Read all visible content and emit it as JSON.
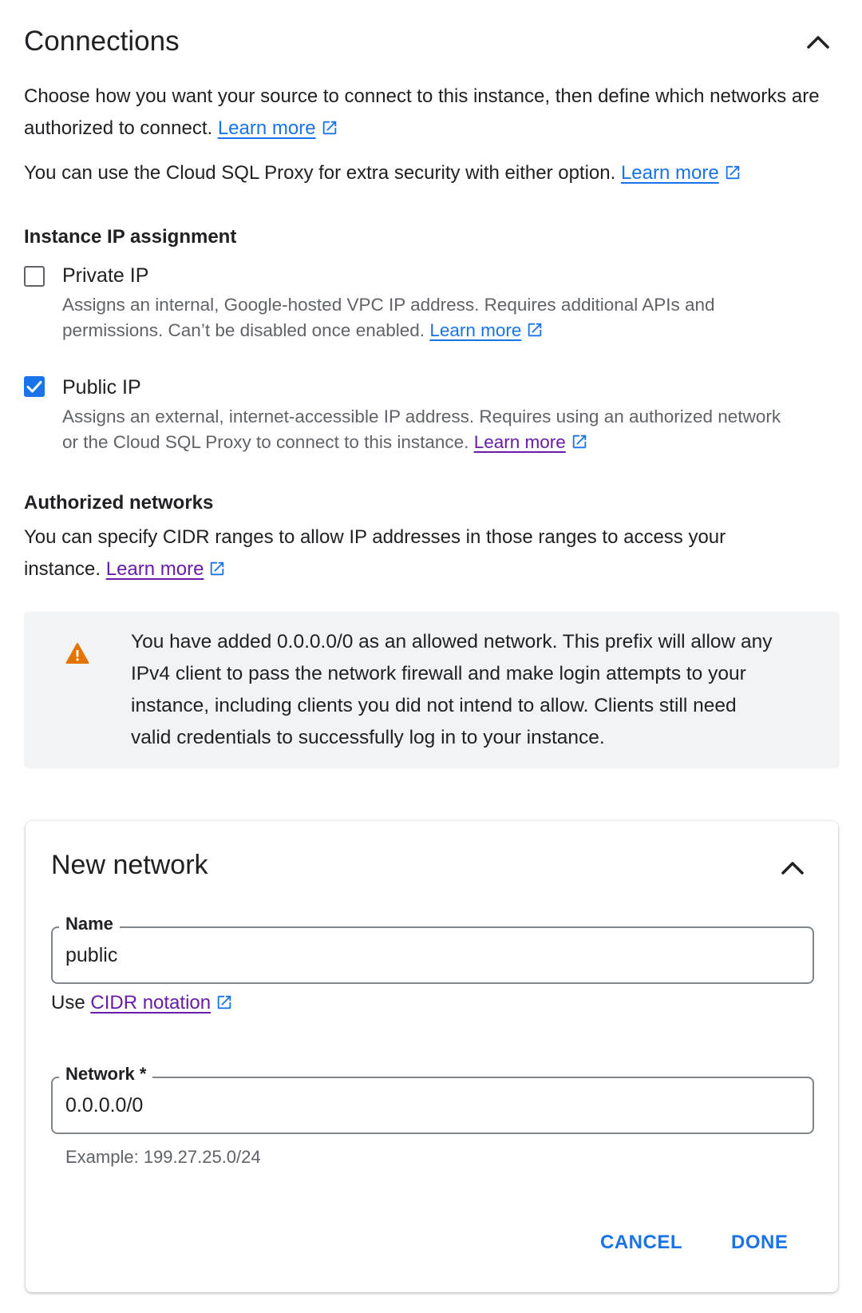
{
  "connections": {
    "title": "Connections",
    "intro_text": "Choose how you want your source to connect to this instance, then define which networks are authorized to connect.",
    "intro_link": "Learn more",
    "proxy_text": "You can use the Cloud SQL Proxy for extra security with either option.",
    "proxy_link": "Learn more"
  },
  "ip_assignment": {
    "heading": "Instance IP assignment",
    "private": {
      "label": "Private IP",
      "checked": false,
      "desc_line1": "Assigns an internal, Google-hosted VPC IP address. Requires additional APIs and",
      "desc_line2": "permissions. Can’t be disabled once enabled.",
      "link": "Learn more"
    },
    "public": {
      "label": "Public IP",
      "checked": true,
      "desc_line1": "Assigns an external, internet-accessible IP address. Requires using an authorized network",
      "desc_line2": "or the Cloud SQL Proxy to connect to this instance.",
      "link": "Learn more"
    }
  },
  "authorized_networks": {
    "heading": "Authorized networks",
    "text_line1": "You can specify CIDR ranges to allow IP addresses in those ranges to access your",
    "text_line2": "instance.",
    "link": "Learn more"
  },
  "warning": {
    "icon": "warning-icon",
    "color": "#e37400",
    "line1": "You have added 0.0.0.0/0 as an allowed network. This prefix will allow any",
    "line2": "IPv4 client to pass the network firewall and make login attempts to your",
    "line3": "instance, including clients you did not intend to allow. Clients still need",
    "line4": "valid credentials to successfully log in to your instance."
  },
  "new_network": {
    "title": "New network",
    "name_label": "Name",
    "name_value": "public",
    "cidr_prefix": "Use",
    "cidr_link": "CIDR notation",
    "network_label": "Network *",
    "network_value": "0.0.0.0/0",
    "network_hint": "Example: 199.27.25.0/24",
    "cancel_label": "CANCEL",
    "done_label": "DONE"
  },
  "colors": {
    "accent": "#1a73e8",
    "visited_link": "#681da8",
    "warning_bg": "#f1f3f4"
  }
}
